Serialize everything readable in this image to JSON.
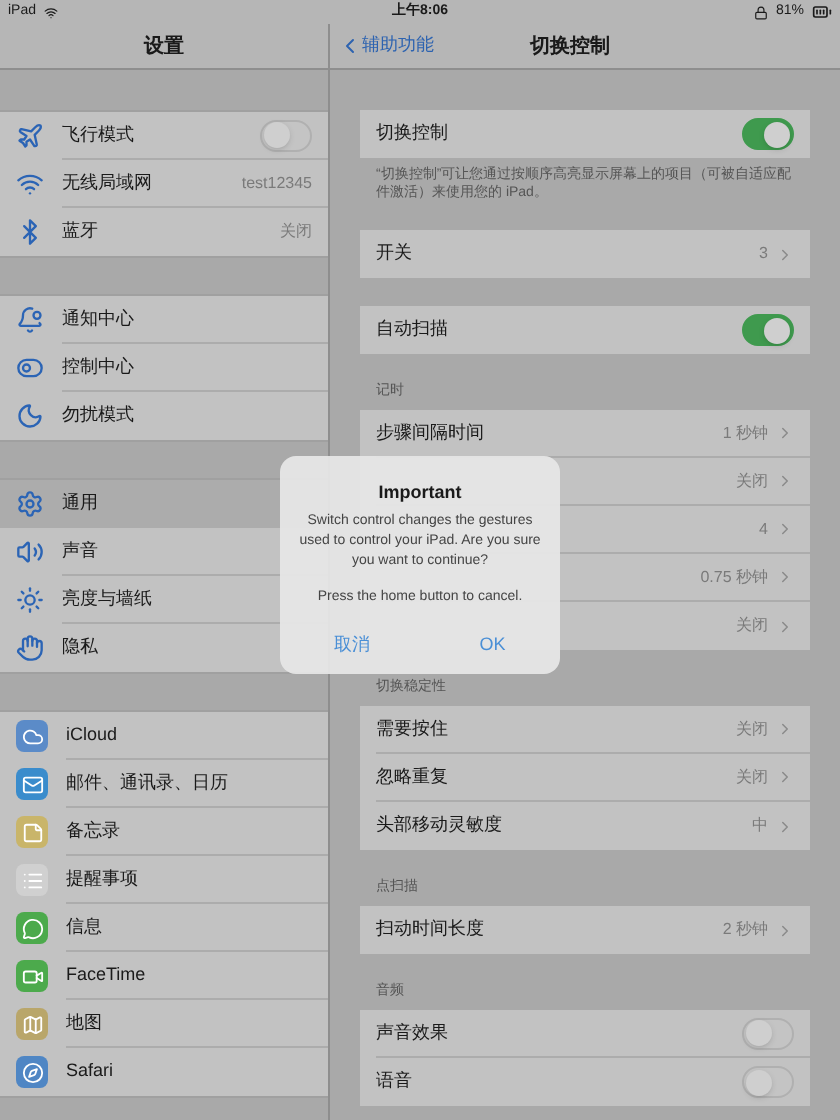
{
  "status_bar": {
    "carrier": "iPad",
    "time": "上午8:06",
    "battery": "81%"
  },
  "sidebar": {
    "title": "设置",
    "groups": [
      [
        {
          "label": "飞行模式",
          "kind": "toggle",
          "on": false,
          "selected": false
        },
        {
          "label": "无线局域网",
          "kind": "link",
          "value": "test12345",
          "selected": false
        },
        {
          "label": "蓝牙",
          "kind": "link",
          "value": "关闭",
          "selected": false
        }
      ],
      [
        {
          "label": "通知中心",
          "kind": "link",
          "selected": false
        },
        {
          "label": "控制中心",
          "kind": "link",
          "selected": false
        },
        {
          "label": "勿扰模式",
          "kind": "link",
          "selected": false
        }
      ],
      [
        {
          "label": "通用",
          "kind": "link",
          "selected": true
        },
        {
          "label": "声音",
          "kind": "link",
          "selected": false
        },
        {
          "label": "亮度与墙纸",
          "kind": "link",
          "selected": false
        },
        {
          "label": "隐私",
          "kind": "link",
          "selected": false
        }
      ],
      [
        {
          "label": "iCloud",
          "kind": "link",
          "selected": false
        },
        {
          "label": "邮件、通讯录、日历",
          "kind": "link",
          "selected": false
        },
        {
          "label": "备忘录",
          "kind": "link",
          "selected": false
        },
        {
          "label": "提醒事项",
          "kind": "link",
          "selected": false
        },
        {
          "label": "信息",
          "kind": "link",
          "selected": false
        },
        {
          "label": "FaceTime",
          "kind": "link",
          "selected": false
        },
        {
          "label": "地图",
          "kind": "link",
          "selected": false
        },
        {
          "label": "Safari",
          "kind": "link",
          "selected": false
        }
      ]
    ]
  },
  "detail": {
    "back": "辅助功能",
    "title": "切换控制",
    "sections": [
      {
        "rows": [
          {
            "label": "切换控制",
            "kind": "toggle",
            "on": true
          }
        ],
        "footer": "“切换控制”可让您通过按顺序高亮显示屏幕上的项目（可被自适应配件激活）来使用您的 iPad。"
      },
      {
        "rows": [
          {
            "label": "开关",
            "kind": "link",
            "value": "3"
          }
        ]
      },
      {
        "rows": [
          {
            "label": "自动扫描",
            "kind": "toggle",
            "on": true
          }
        ]
      },
      {
        "header": "记时",
        "rows": [
          {
            "label": "步骤间隔时间",
            "kind": "link",
            "value": "1 秒钟"
          },
          {
            "kind": "link",
            "value": "关闭"
          },
          {
            "kind": "link",
            "value": "4"
          },
          {
            "kind": "link",
            "value": "0.75 秒钟"
          },
          {
            "kind": "link",
            "value": "关闭"
          }
        ]
      },
      {
        "header": "切换稳定性",
        "rows": [
          {
            "label": "需要按住",
            "kind": "link",
            "value": "关闭"
          },
          {
            "label": "忽略重复",
            "kind": "link",
            "value": "关闭"
          },
          {
            "label": "头部移动灵敏度",
            "kind": "link",
            "value": "中"
          }
        ]
      },
      {
        "header": "点扫描",
        "rows": [
          {
            "label": "扫动时间长度",
            "kind": "link",
            "value": "2 秒钟"
          }
        ]
      },
      {
        "header": "音频",
        "rows": [
          {
            "label": "声音效果",
            "kind": "toggle",
            "on": false
          },
          {
            "label": "语音",
            "kind": "toggle",
            "on": false
          }
        ]
      }
    ]
  },
  "alert": {
    "title": "Important",
    "message": "Switch control changes the gestures used to control your iPad. Are you sure you want to continue?",
    "note": "Press the home button to cancel.",
    "buttons": [
      "取消",
      "OK"
    ]
  }
}
